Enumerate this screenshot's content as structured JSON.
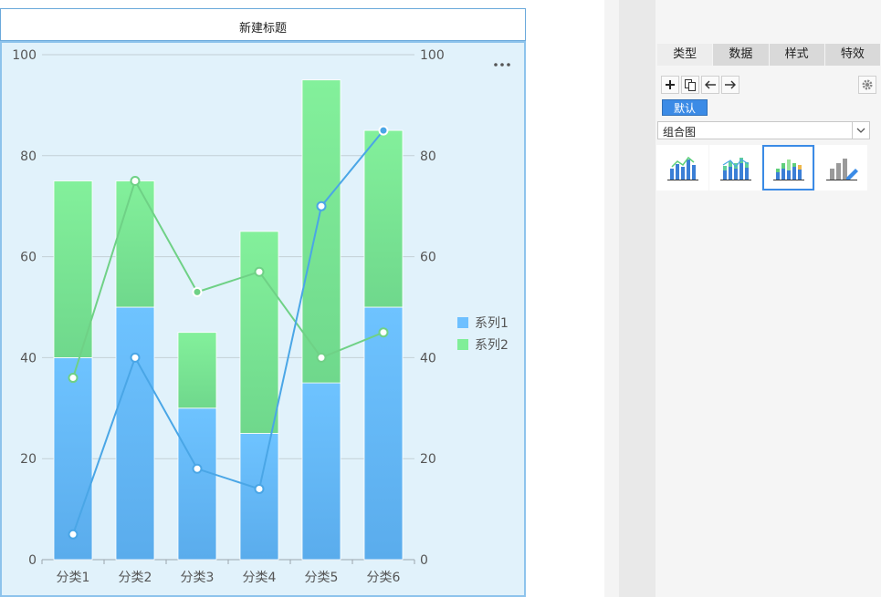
{
  "chart_title": "新建标题",
  "more_icon": "ellipsis-icon",
  "chart_data": {
    "type": "bar",
    "categories": [
      "分类1",
      "分类2",
      "分类3",
      "分类4",
      "分类5",
      "分类6"
    ],
    "stacked": true,
    "series": [
      {
        "name": "系列1",
        "kind": "bar",
        "values": [
          40,
          50,
          30,
          25,
          35,
          50
        ],
        "color": "#6ec0ff"
      },
      {
        "name": "系列2",
        "kind": "bar",
        "values": [
          35,
          25,
          15,
          40,
          60,
          35
        ],
        "color": "#80ee98"
      }
    ],
    "line_series": [
      {
        "name": "系列1",
        "values": [
          5,
          40,
          18,
          14,
          70,
          85
        ],
        "color": "#4aa6e6"
      },
      {
        "name": "系列2",
        "values": [
          36,
          75,
          53,
          57,
          40,
          45
        ],
        "color": "#6fd186"
      }
    ],
    "y_ticks": [
      "0",
      "20",
      "40",
      "60",
      "80",
      "100"
    ],
    "ylim": [
      0,
      100
    ],
    "y2lim": [
      0,
      100
    ],
    "grid": true,
    "legend_position": "right"
  },
  "panel": {
    "tabs": [
      {
        "label": "类型",
        "active": true
      },
      {
        "label": "数据",
        "active": false
      },
      {
        "label": "样式",
        "active": false
      },
      {
        "label": "特效",
        "active": false
      }
    ],
    "toolbar_icons": [
      "plus-icon",
      "copy-icon",
      "arrow-left-icon",
      "arrow-right-icon"
    ],
    "gear_icon": "gear-icon",
    "default_chip": "默认",
    "chart_type_select": "组合图",
    "thumbnails": [
      "bar-line-icon",
      "stacked-bar-line-icon",
      "stacked-bar-combo-icon",
      "bar-edit-icon"
    ],
    "selected_thumbnail": 2
  }
}
